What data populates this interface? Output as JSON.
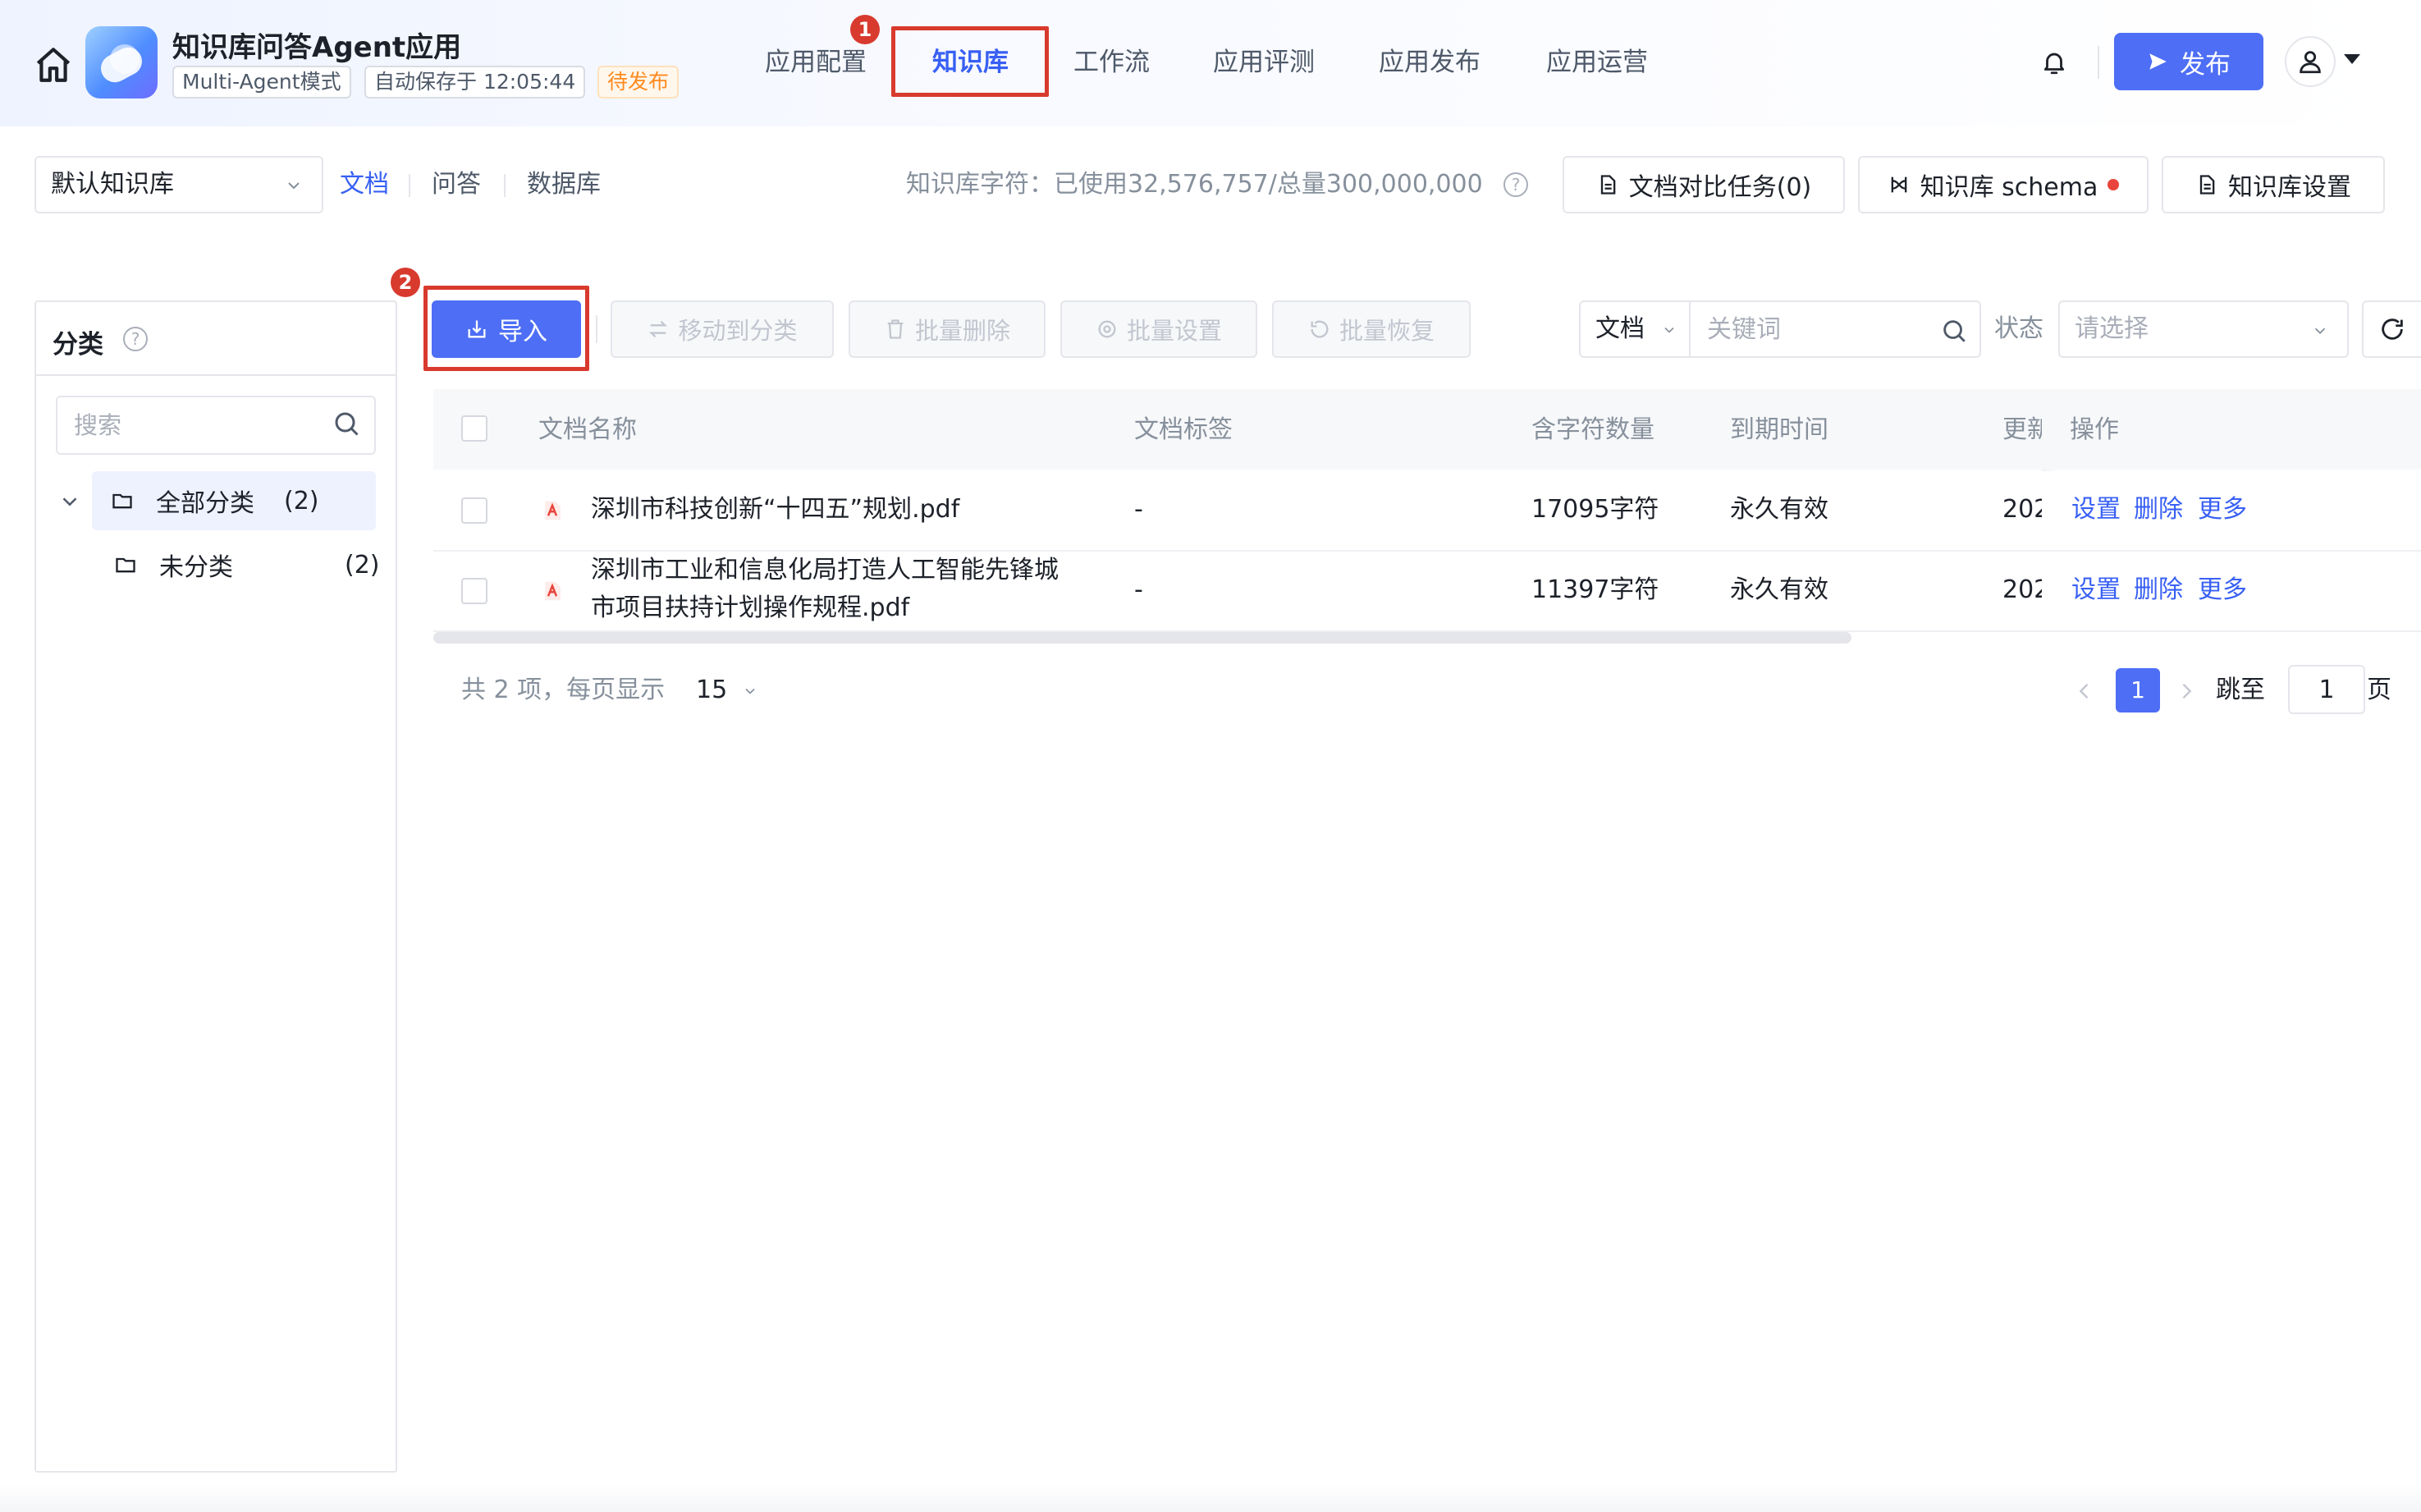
{
  "header": {
    "app_title": "知识库问答Agent应用",
    "mode_tag": "Multi-Agent模式",
    "autosave_tag": "自动保存于 12:05:44",
    "status_tag": "待发布",
    "nav_tabs": [
      {
        "label": "应用配置"
      },
      {
        "label": "知识库"
      },
      {
        "label": "工作流"
      },
      {
        "label": "应用评测"
      },
      {
        "label": "应用发布"
      },
      {
        "label": "应用运营"
      }
    ],
    "active_tab": "知识库",
    "publish_label": "发布",
    "step_badges": [
      "1",
      "2"
    ]
  },
  "subbar": {
    "kb_select": "默认知识库",
    "tabs": [
      {
        "label": "文档"
      },
      {
        "label": "问答"
      },
      {
        "label": "数据库"
      }
    ],
    "quota": "知识库字符：已使用32,576,757/总量300,000,000",
    "help": "?",
    "compare_task_label": "文档对比任务(0)",
    "schema_label": "知识库 schema",
    "settings_label": "知识库设置"
  },
  "left_panel": {
    "title": "分类",
    "help": "?",
    "search_placeholder": "搜索",
    "tree": [
      {
        "label": "全部分类",
        "count": "(2)"
      },
      {
        "label": "未分类",
        "count": "(2)"
      }
    ]
  },
  "toolbar": {
    "import_label": "导入",
    "move_label": "移动到分类",
    "batch_delete_label": "批量删除",
    "batch_settings_label": "批量设置",
    "batch_restore_label": "批量恢复",
    "filter_type": "文档",
    "keyword_placeholder": "关键词",
    "status_label": "状态",
    "status_placeholder": "请选择"
  },
  "table": {
    "columns": [
      "文档名称",
      "文档标签",
      "含字符数量",
      "到期时间",
      "更新",
      "操作"
    ],
    "rows": [
      {
        "name_line1": "深圳市科技创新“十四五”规划.pdf",
        "name_line2": "",
        "tag": "-",
        "chars": "17095字符",
        "expiry": "永久有效",
        "updated": "202"
      },
      {
        "name_line1": "深圳市工业和信息化局打造人工智能先锋城",
        "name_line2": "市项目扶持计划操作规程.pdf",
        "tag": "-",
        "chars": "11397字符",
        "expiry": "永久有效",
        "updated": "202"
      }
    ],
    "actions": {
      "settings": "设置",
      "delete": "删除",
      "more": "更多"
    }
  },
  "pagination": {
    "total_text": "共 2 项，每页显示",
    "page_size": "15",
    "current_page": "1",
    "jump_label": "跳至",
    "jump_value": "1",
    "page_unit": "页"
  },
  "colors": {
    "primary": "#4d6ef5",
    "link": "#3860f4",
    "highlight": "#d83a2e",
    "status_orange": "#ff8a1f"
  }
}
